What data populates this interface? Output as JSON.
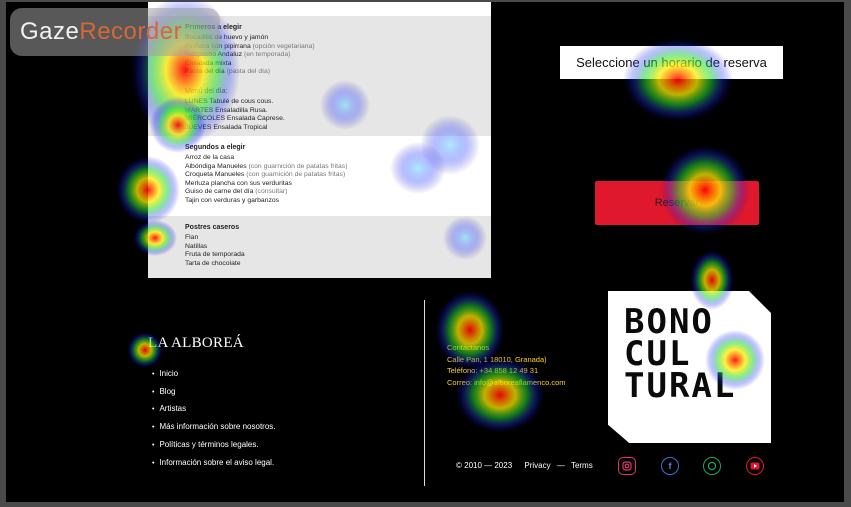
{
  "menu": {
    "first_courses": {
      "title": "Primeros a elegir",
      "items": [
        {
          "text": "Bocadillo de huevo y jamón",
          "note": ""
        },
        {
          "text": "Piriñaca con pipirrana",
          "note": "(opción vegetariana)"
        },
        {
          "text": "Gazpacho Andaluz",
          "note": "(en temporada)"
        },
        {
          "text": "Ensalada mixta",
          "note": ""
        },
        {
          "text": "Pasta del día",
          "note": "(pasta del día)"
        }
      ]
    },
    "of_the_day": {
      "title": "Menú del día:",
      "items": [
        {
          "text": "LUNES Tabulé de cous cous.",
          "note": ""
        },
        {
          "text": "MARTES Ensaladilla Rusa.",
          "note": ""
        },
        {
          "text": "MIÉRCOLES Ensalada Caprese.",
          "note": ""
        },
        {
          "text": "JUEVES Ensalada Tropical",
          "note": ""
        }
      ]
    },
    "second_courses": {
      "title": "Segundos a elegir",
      "items": [
        {
          "text": "Arroz de la casa",
          "note": ""
        },
        {
          "text": "Albóndiga Manueles",
          "note": "(con guarnición de patatas fritas)"
        },
        {
          "text": "Croqueta Manueles",
          "note": "(con guarnición de patatas fritas)"
        },
        {
          "text": "Merluza plancha con sus verduritas",
          "note": ""
        },
        {
          "text": "Guiso de carne del día",
          "note": "(consultar)"
        },
        {
          "text": "Tajin con verduras y garbanzos",
          "note": ""
        }
      ]
    },
    "desserts": {
      "title": "Postres caseros",
      "items": [
        {
          "text": "Flan",
          "note": ""
        },
        {
          "text": "Natillas",
          "note": ""
        },
        {
          "text": "Fruta de temporada",
          "note": ""
        },
        {
          "text": "Tarta de chocolate",
          "note": ""
        }
      ]
    }
  },
  "reservation": {
    "schedule_label": "Seleccione un horario de reserva",
    "button_label": "Reservar"
  },
  "footer": {
    "brand": "LA ALBOREÁ",
    "links": [
      "Inicio",
      "Blog",
      "Artistas",
      "Más información sobre nosotros.",
      "Políticas y términos legales.",
      "Información sobre el aviso legal."
    ],
    "contact": [
      "Contáctanos",
      "Calle Pan, 1 18010, Granada)",
      "Teléfono: +34 858 12 49 31",
      "Correo: info@alboreaflamenco.com"
    ],
    "copyright": "© 2010 — 2023",
    "privacy": "Privacy",
    "separator": "—",
    "terms": "Terms"
  },
  "bono_logo": [
    "BONO",
    "CUL",
    "TURAL"
  ],
  "social": {
    "instagram_icon": "instagram-icon",
    "facebook_icon": "facebook-icon",
    "whatsapp_icon": "whatsapp-icon",
    "youtube_icon": "youtube-icon"
  },
  "watermark": {
    "part1": "Gaze",
    "part2": "Recorder"
  },
  "colors": {
    "background": "#000000",
    "reserve_button": "#e0182d",
    "contact_text": "#ffd21f",
    "watermark_accent": "#d8663a"
  }
}
